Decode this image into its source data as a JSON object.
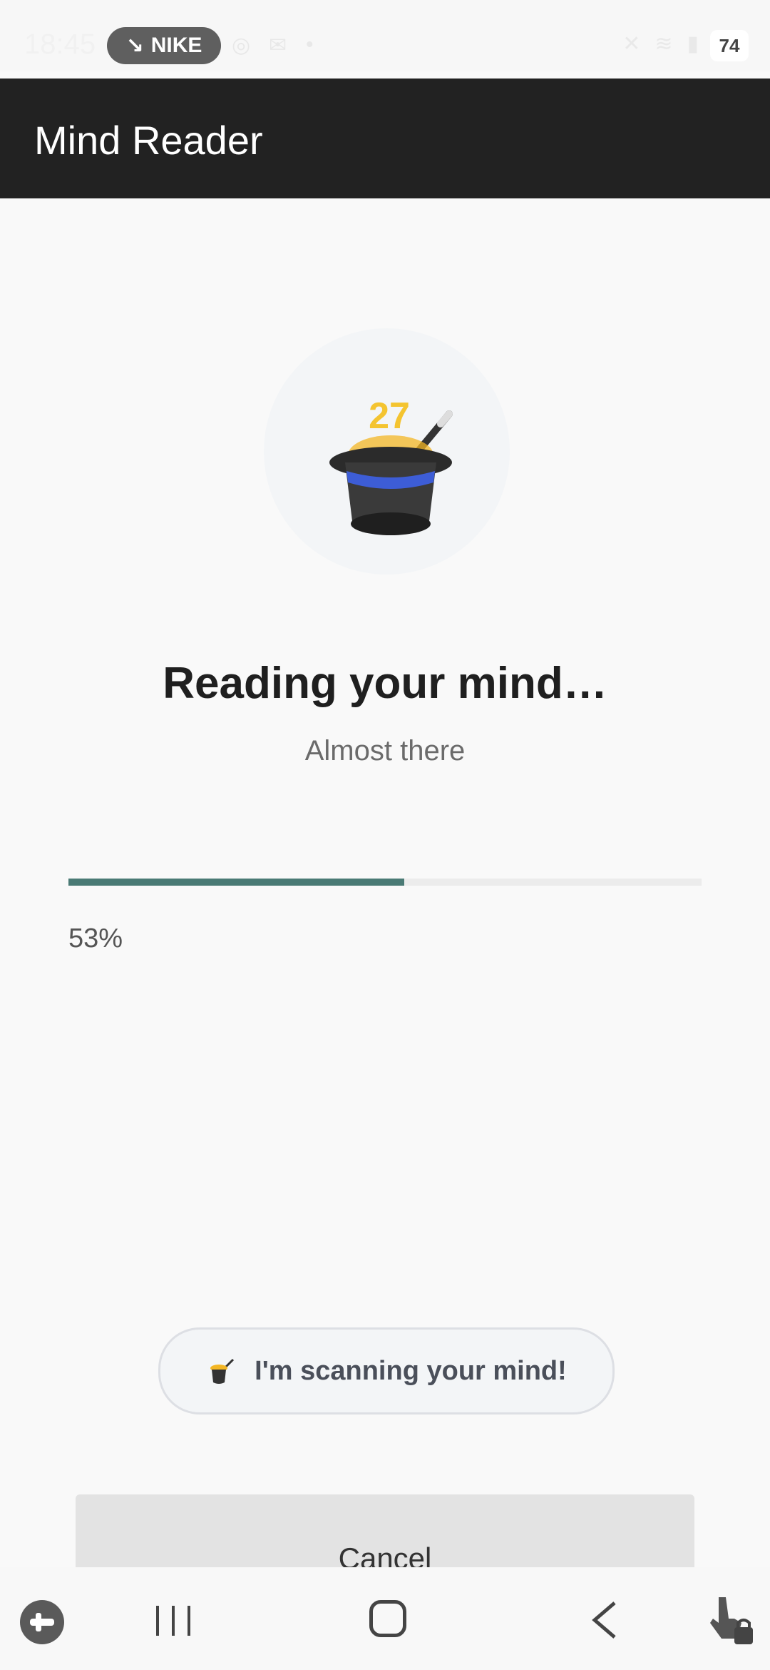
{
  "status_bar": {
    "time": "18:45",
    "pill_label": "NIKE",
    "battery": "74"
  },
  "app_bar": {
    "title": "Mind Reader"
  },
  "hero": {
    "icon": "magic-hat-icon",
    "number": "27"
  },
  "main": {
    "headline": "Reading your mind…",
    "subline": "Almost there"
  },
  "progress": {
    "value": 0.53,
    "label": "53%",
    "fill_color": "#4a7a75"
  },
  "toast": {
    "text": "I'm scanning your mind!"
  },
  "actions": {
    "cancel_label": "Cancel"
  },
  "nav": {
    "items": [
      "game-launcher-icon",
      "recents-icon",
      "home-icon",
      "back-icon",
      "touch-lock-icon"
    ]
  }
}
